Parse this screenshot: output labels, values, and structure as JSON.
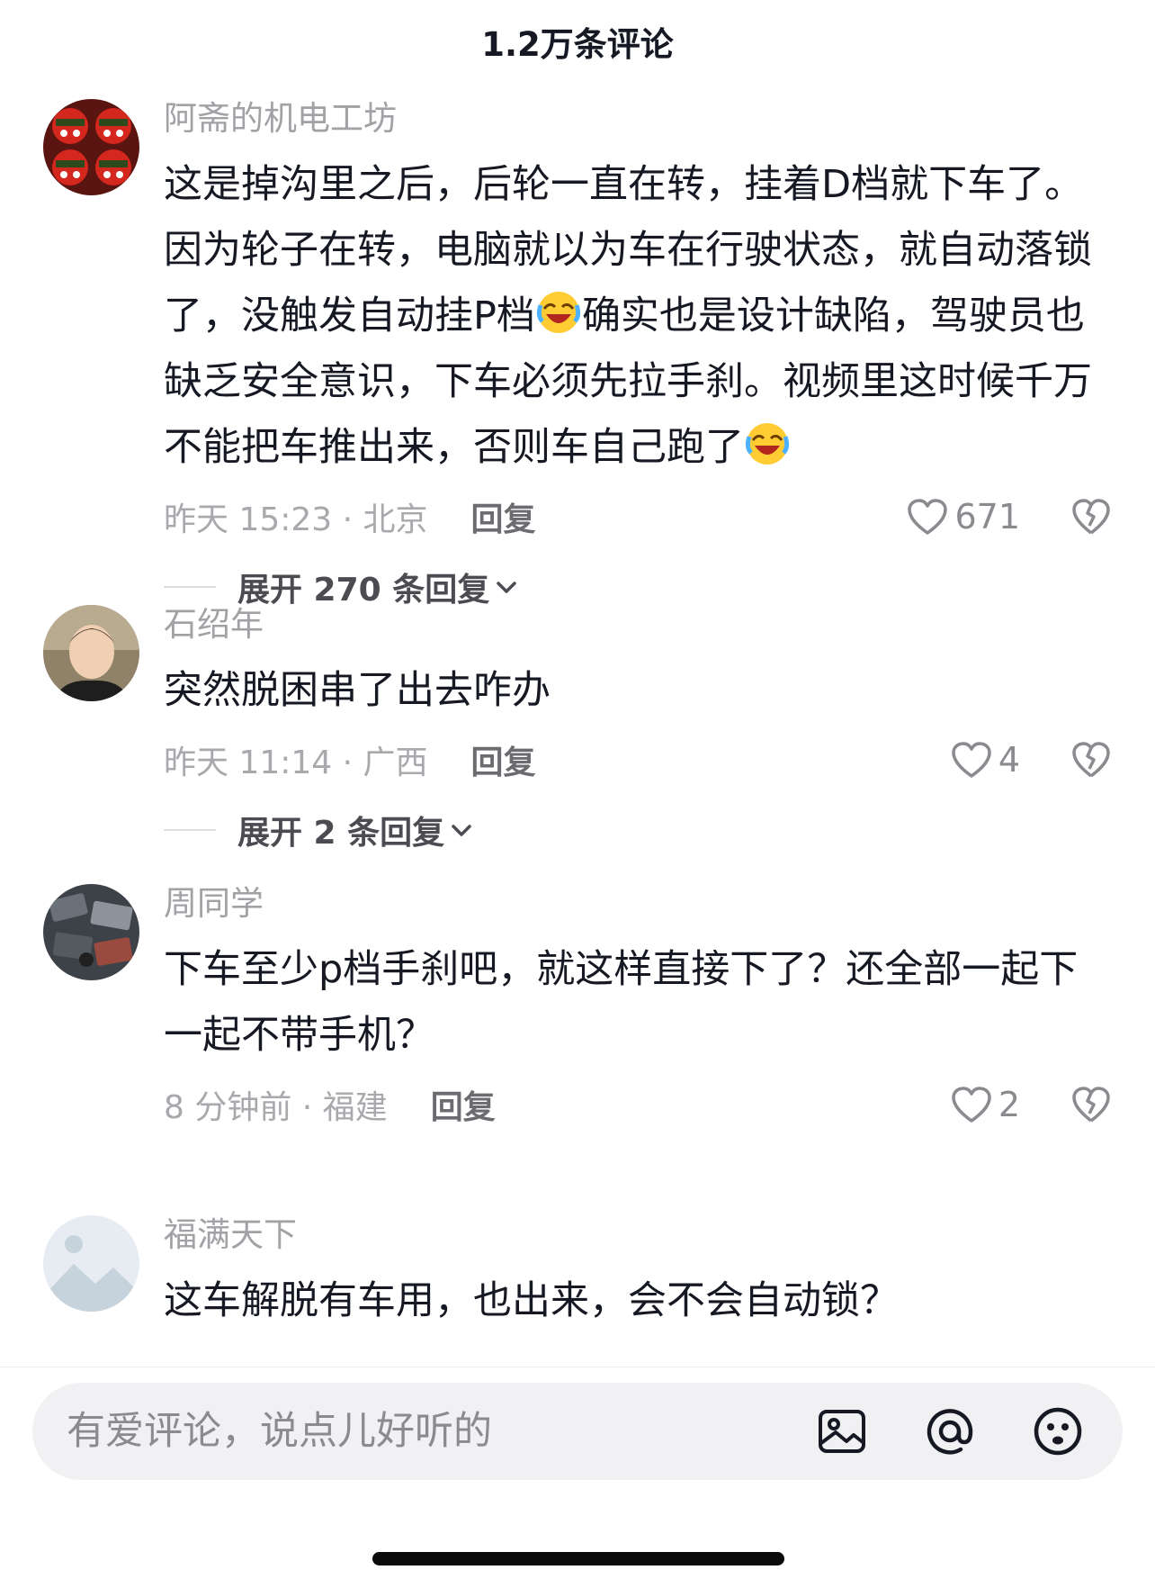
{
  "header": {
    "title": "1.2万条评论"
  },
  "comments": [
    {
      "username": "阿斋的机电工坊",
      "content_part1": "这是掉沟里之后，后轮一直在转，挂着D档就下车了。因为轮子在转，电脑就以为车在行驶状态，就自动落锁了，没触发自动挂P档",
      "content_part2": "确实也是设计缺陷，驾驶员也缺乏安全意识，下车必须先拉手刹。视频里这时候千万不能把车推出来，否则车自己跑了",
      "meta": "昨天 15:23 · 北京",
      "reply_label": "回复",
      "likes": "671",
      "expand_label": "展开 270 条回复"
    },
    {
      "username": "石绍年",
      "content": "突然脱困串了出去咋办",
      "meta": "昨天 11:14 · 广西",
      "reply_label": "回复",
      "likes": "4",
      "expand_label": "展开 2 条回复"
    },
    {
      "username": "周同学",
      "content": "下车至少p档手刹吧，就这样直接下了？还全部一起下一起不带手机？",
      "meta": "8 分钟前 · 福建",
      "reply_label": "回复",
      "likes": "2"
    },
    {
      "username": "福满天下",
      "content": "这车解脱有车用，也出来，会不会自动锁？"
    }
  ],
  "input_bar": {
    "placeholder": "有爱评论，说点儿好听的",
    "icons": [
      "image-icon",
      "at-icon",
      "emoji-icon"
    ]
  },
  "colors": {
    "text_primary": "#161823",
    "text_secondary": "#a1a1a6",
    "input_bg": "#f1f1f3"
  }
}
